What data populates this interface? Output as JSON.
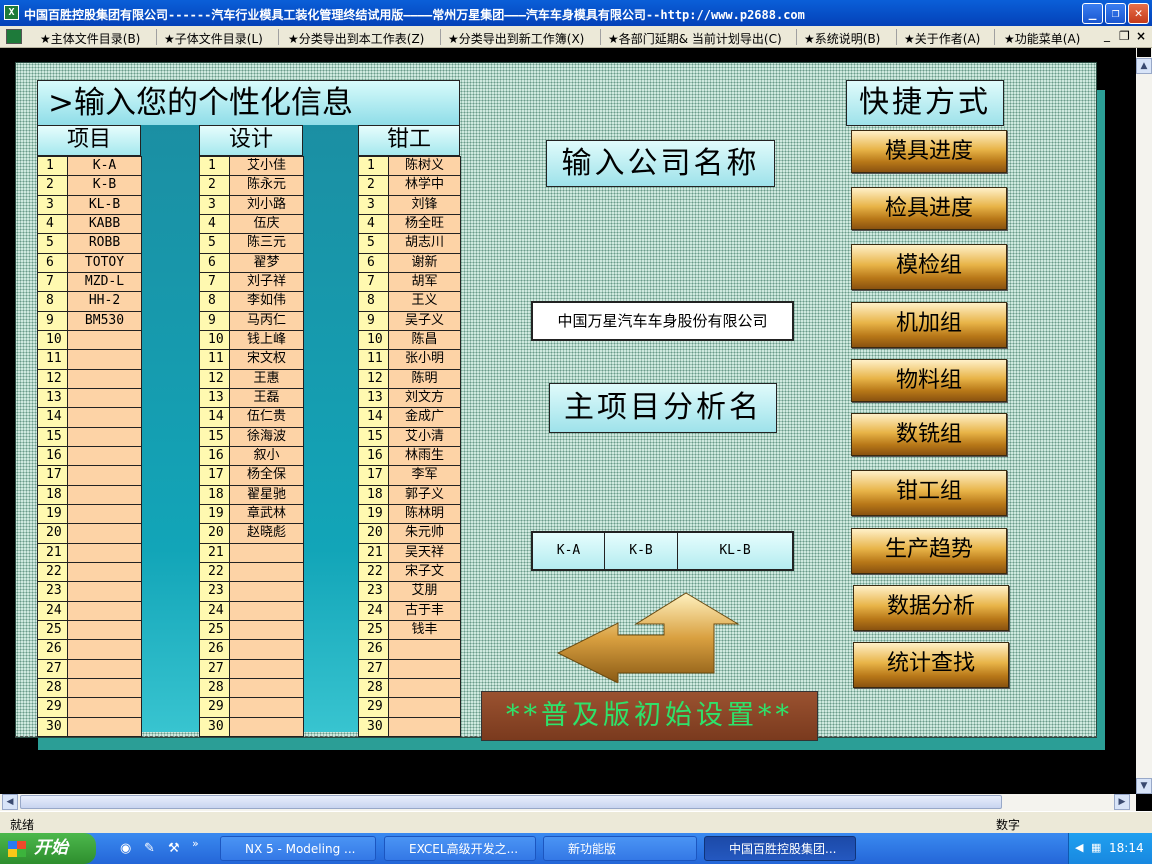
{
  "window": {
    "title": "中国百胜控股集团有限公司------汽车行业模具工装化管理终结试用版————常州万星集团———汽车车身模具有限公司--http://www.p2688.com"
  },
  "menu": [
    "★主体文件目录(B)",
    "★子体文件目录(L)",
    "★分类导出到本工作表(Z)",
    "★分类导出到新工作簿(X)",
    "★各部门延期& 当前计划导出(C)",
    "★系统说明(B)",
    "★关于作者(A)",
    "★功能菜单(A)"
  ],
  "sheet": {
    "panel_title": ">输入您的个性化信息",
    "columns": {
      "project": {
        "header": "项目",
        "numbers": [
          "1",
          "2",
          "3",
          "4",
          "5",
          "6",
          "7",
          "8",
          "9",
          "10",
          "11",
          "12",
          "13",
          "14",
          "15",
          "16",
          "17",
          "18",
          "19",
          "20",
          "21",
          "22",
          "23",
          "24",
          "25",
          "26",
          "27",
          "28",
          "29",
          "30"
        ],
        "values": [
          "K-A",
          "K-B",
          "KL-B",
          "KABB",
          "ROBB",
          "TOTOY",
          "MZD-L",
          "HH-2",
          "BM530",
          "",
          "",
          "",
          "",
          "",
          "",
          "",
          "",
          "",
          "",
          "",
          "",
          "",
          "",
          "",
          "",
          "",
          "",
          "",
          "",
          ""
        ]
      },
      "design": {
        "header": "设计",
        "numbers": [
          "1",
          "2",
          "3",
          "4",
          "5",
          "6",
          "7",
          "8",
          "9",
          "10",
          "11",
          "12",
          "13",
          "14",
          "15",
          "16",
          "17",
          "18",
          "19",
          "20",
          "21",
          "22",
          "23",
          "24",
          "25",
          "26",
          "27",
          "28",
          "29",
          "30"
        ],
        "values": [
          "艾小佳",
          "陈永元",
          "刘小路",
          "伍庆",
          "陈三元",
          "翟梦",
          "刘子祥",
          "李如伟",
          "马丙仁",
          "钱上峰",
          "宋文权",
          "王惠",
          "王磊",
          "伍仁贵",
          "徐海波",
          "叙小",
          "杨全保",
          "翟星驰",
          "章武林",
          "赵晓彪",
          "",
          "",
          "",
          "",
          "",
          "",
          "",
          "",
          "",
          ""
        ]
      },
      "fitter": {
        "header": "钳工",
        "numbers": [
          "1",
          "2",
          "3",
          "4",
          "5",
          "6",
          "7",
          "8",
          "9",
          "10",
          "11",
          "12",
          "13",
          "14",
          "15",
          "16",
          "17",
          "18",
          "19",
          "20",
          "21",
          "22",
          "23",
          "24",
          "25",
          "26",
          "27",
          "28",
          "29",
          "30"
        ],
        "values": [
          "陈树义",
          "林学中",
          "刘锋",
          "杨全旺",
          "胡志川",
          "谢新",
          "胡军",
          "王义",
          "吴子义",
          "陈昌",
          "张小明",
          "陈明",
          "刘文方",
          "金成广",
          "艾小清",
          "林雨生",
          "李军",
          "郭子义",
          "陈林明",
          "朱元帅",
          "吴天祥",
          "宋子文",
          "艾朋",
          "古于丰",
          "钱丰",
          "",
          "",
          "",
          "",
          ""
        ]
      }
    },
    "company_label": "输入公司名称",
    "company_name": "中国万星汽车车身股份有限公司",
    "main_project_label": "主项目分析名",
    "main_projects": [
      "K-A",
      "K-B",
      "KL-B"
    ],
    "init_button": "**普及版初始设置**",
    "shortcuts_title": "快捷方式",
    "shortcuts": [
      "模具进度",
      "检具进度",
      "模检组",
      "机加组",
      "物料组",
      "数铣组",
      "钳工组",
      "生产趋势",
      "数据分析",
      "统计查找"
    ]
  },
  "status": {
    "ready": "就绪",
    "mode": "数字"
  },
  "taskbar": {
    "start": "开始",
    "tasks": [
      "NX 5 - Modeling ...",
      "EXCEL高级开发之...",
      "新功能版",
      "中国百胜控股集团..."
    ],
    "clock": "18:14"
  }
}
